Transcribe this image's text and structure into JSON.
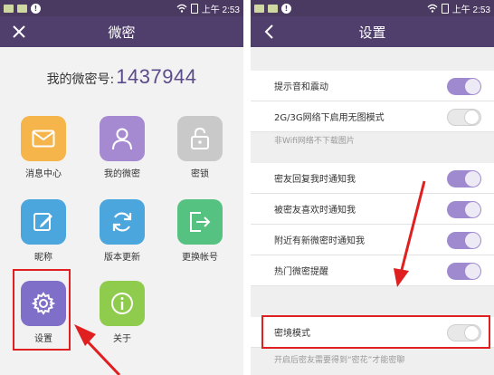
{
  "status": {
    "left_time": "上午 2:53",
    "right_time": "上午 2:53",
    "warn_glyph": "!"
  },
  "left": {
    "title": "微密",
    "id_label": "我的微密号:",
    "id_value": "1437944",
    "tiles": [
      {
        "label": "消息中心",
        "icon": "envelope-icon",
        "color": "#f5b54a"
      },
      {
        "label": "我的微密",
        "icon": "person-icon",
        "color": "#a58ad2"
      },
      {
        "label": "密锁",
        "icon": "lock-icon",
        "color": "#c9c9c9"
      },
      {
        "label": "昵称",
        "icon": "edit-icon",
        "color": "#4aa6dc"
      },
      {
        "label": "版本更新",
        "icon": "refresh-icon",
        "color": "#4aa6dc"
      },
      {
        "label": "更换帐号",
        "icon": "switch-account-icon",
        "color": "#55c282"
      },
      {
        "label": "设置",
        "icon": "gear-icon",
        "color": "#7f6fc8"
      },
      {
        "label": "关于",
        "icon": "info-icon",
        "color": "#8fcc4e"
      }
    ]
  },
  "right": {
    "title": "设置",
    "group1": [
      {
        "label": "提示音和震动",
        "on": true
      },
      {
        "label": "2G/3G网络下启用无图模式",
        "on": false
      }
    ],
    "hint1": "非Wifi网络不下载图片",
    "group2": [
      {
        "label": "密友回复我时通知我",
        "on": true
      },
      {
        "label": "被密友喜欢时通知我",
        "on": true
      },
      {
        "label": "附近有新微密时通知我",
        "on": true
      },
      {
        "label": "热门微密提醒",
        "on": true
      }
    ],
    "secret_mode": {
      "label": "密境模式",
      "on": false
    },
    "hint2": "开启后密友需要得到“密花”才能密聊"
  },
  "colors": {
    "statusbar": "#4a3a62",
    "titlebar": "#503f6d",
    "toggle_on": "#9f8ad0",
    "highlight": "#e02020",
    "id_value": "#5c4b8a"
  }
}
